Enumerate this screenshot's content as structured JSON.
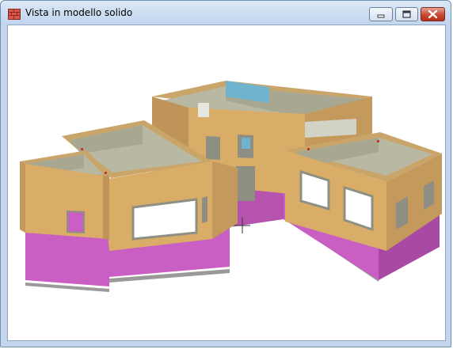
{
  "window": {
    "title": "Vista in modello solido",
    "icon": "brick-wall-icon",
    "controls": {
      "minimize_icon": "minimize-icon",
      "maximize_icon": "maximize-icon",
      "close_icon": "close-icon"
    }
  },
  "colors": {
    "wall_top": "#c9a56a",
    "wall_front": "#d9ad67",
    "wall_side": "#bf9458",
    "foundation": "#c95fc2",
    "foundation_dark": "#a84aa3",
    "floor": "#b9b9a3",
    "inner_wall": "#a8a892",
    "beam": "#6fb3cf",
    "shadow": "#9a9a9a"
  }
}
